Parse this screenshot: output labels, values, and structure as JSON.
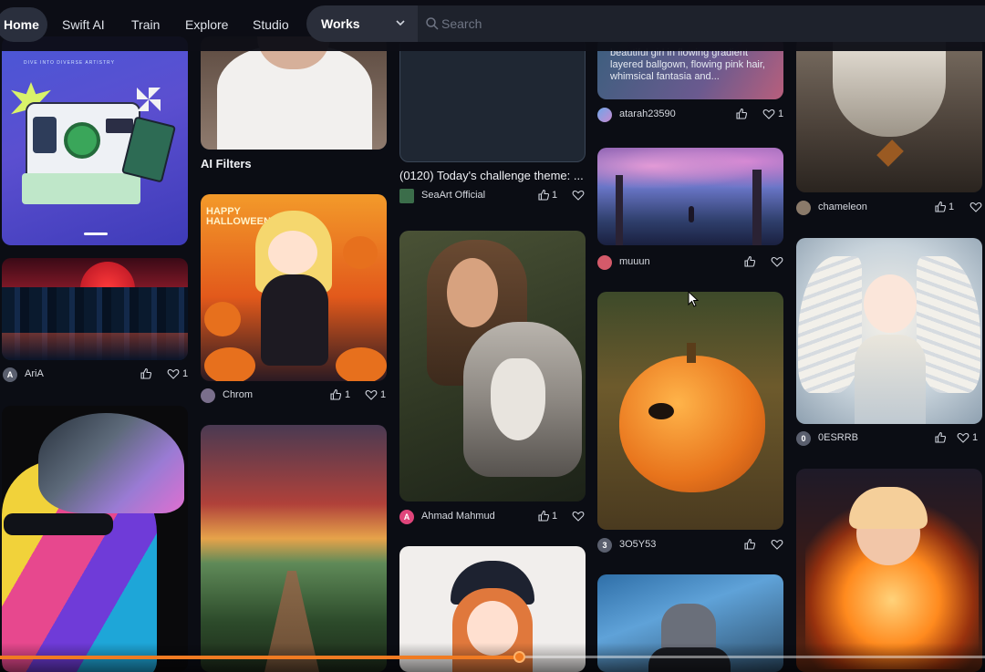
{
  "nav": {
    "items": [
      "Home",
      "Swift AI",
      "Train",
      "Explore",
      "Studio"
    ],
    "works_label": "Works",
    "search_placeholder": "Search"
  },
  "col1": {
    "banner_text": "DIVE INTO DIVERSE ARTISTRY",
    "card_aria": {
      "user": "AriA",
      "avatar_letter": "A",
      "fav_count": "1"
    }
  },
  "col2": {
    "filters_label": "AI Filters",
    "halloween_text": "HAPPY HALLOWEEN",
    "card_chrom": {
      "user": "Chrom",
      "like_count": "1",
      "fav_count": "1"
    }
  },
  "col3": {
    "challenge_caption": "(0120) Today's challenge theme: ...",
    "card_seaart": {
      "user": "SeaArt Official",
      "like_count": "1"
    },
    "card_ahmad": {
      "user": "Ahmad Mahmud",
      "avatar_letter": "A",
      "like_count": "1"
    }
  },
  "col4": {
    "prompt_text": "beautiful girl in flowing gradient layered ballgown, flowing pink hair, whimsical fantasia and...",
    "card_atarah": {
      "user": "atarah23590",
      "fav_count": "1"
    },
    "card_muuun": {
      "user": "muuun"
    },
    "card_3o5y53": {
      "user": "3O5Y53",
      "avatar_letter": "3"
    }
  },
  "col5": {
    "card_chameleon": {
      "user": "chameleon",
      "like_count": "1"
    },
    "card_oesrrb": {
      "user": "0ESRRB",
      "avatar_letter": "0",
      "fav_count": "1"
    }
  },
  "player": {
    "progress": 0.527
  },
  "colors": {
    "accent": "#f07b22",
    "background": "#0b0d14"
  }
}
